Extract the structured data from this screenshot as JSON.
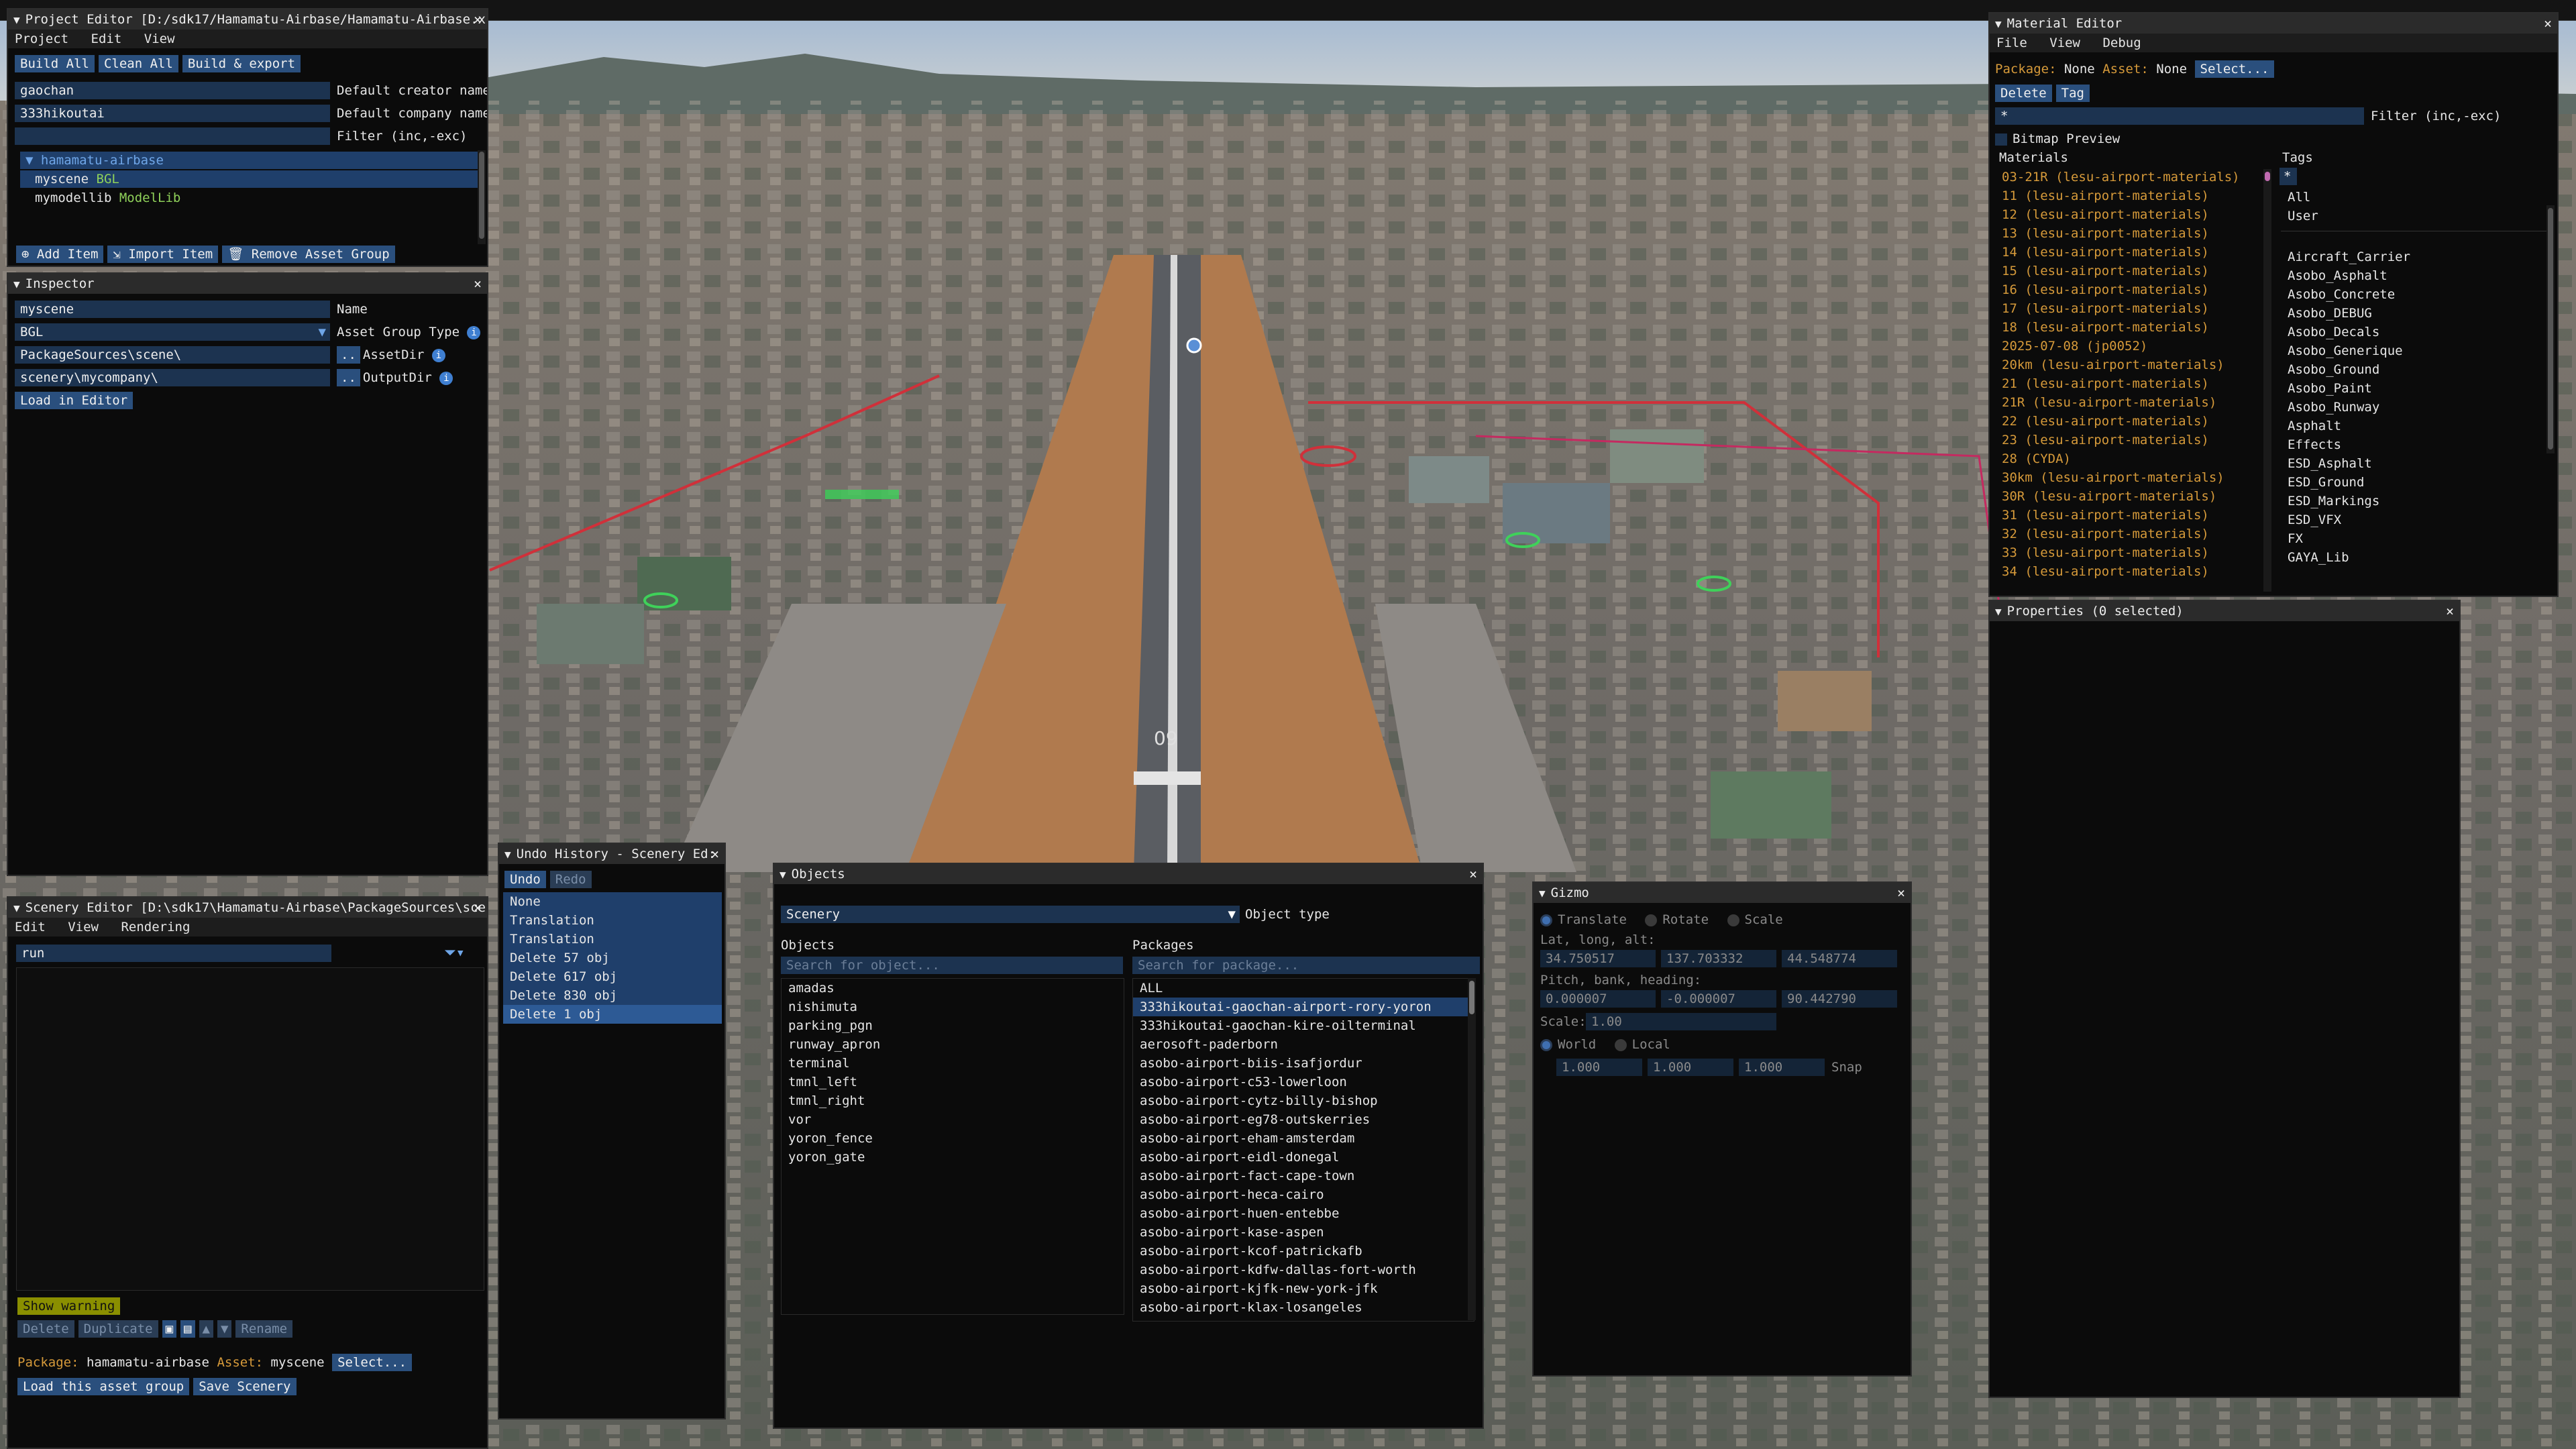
{
  "project_editor": {
    "title": "Project Editor [D:/sdk17/Hamamatu-Airbase/Hamamatu-Airbase.x",
    "menu": [
      "Project",
      "Edit",
      "View"
    ],
    "buttons": {
      "build_all": "Build All",
      "clean_all": "Clean All",
      "build_export": "Build & export"
    },
    "creator_value": "gaochan",
    "creator_label": "Default creator name",
    "company_value": "333hikoutai",
    "company_label": "Default company name",
    "filter_label": "Filter (inc,-exc)",
    "tree": {
      "root": "hamamatu-airbase",
      "item1_name": "myscene",
      "item1_type": "BGL",
      "item2_name": "mymodellib",
      "item2_type": "ModelLib"
    },
    "footer": {
      "add_item": "Add Item",
      "import_item": "Import Item",
      "remove_group": "Remove Asset Group"
    }
  },
  "inspector": {
    "title": "Inspector",
    "name_value": "myscene",
    "name_label": "Name",
    "type_value": "BGL",
    "type_label": "Asset Group Type",
    "assetdir_value": "PackageSources\\scene\\",
    "assetdir_label": "AssetDir",
    "outputdir_value": "scenery\\mycompany\\",
    "outputdir_label": "OutputDir",
    "dots": "..",
    "load_button": "Load in Editor"
  },
  "scenery_editor": {
    "title": "Scenery Editor [D:\\sdk17\\Hamamatu-Airbase\\PackageSources\\sce",
    "menu": [
      "Edit",
      "View",
      "Rendering"
    ],
    "search_value": "run",
    "show_warning": "Show warning",
    "tools": {
      "delete": "Delete",
      "duplicate": "Duplicate",
      "rename": "Rename"
    },
    "package_label": "Package:",
    "package_value": "hamamatu-airbase",
    "asset_label": "Asset:",
    "asset_value": "myscene",
    "select_button": "Select...",
    "load_group": "Load this asset group",
    "save_scenery": "Save Scenery"
  },
  "undo_history": {
    "title": "Undo History - Scenery Ed:",
    "undo": "Undo",
    "redo": "Redo",
    "items": [
      "None",
      "Translation",
      "Translation",
      "Delete 57 obj",
      "Delete 617 obj",
      "Delete 830 obj",
      "Delete 1 obj"
    ]
  },
  "objects": {
    "title": "Objects",
    "type_value": "Scenery",
    "type_label": "Object type",
    "objects_header": "Objects",
    "packages_header": "Packages",
    "objects_placeholder": "Search for object...",
    "packages_placeholder": "Search for package...",
    "object_items": [
      "amadas",
      "nishimuta",
      "parking_pgn",
      "runway_apron",
      "terminal",
      "tmnl_left",
      "tmnl_right",
      "vor",
      "yoron_fence",
      "yoron_gate"
    ],
    "package_items": [
      "ALL",
      "333hikoutai-gaochan-airport-rory-yoron",
      "333hikoutai-gaochan-kire-oilterminal",
      "aerosoft-paderborn",
      "asobo-airport-biis-isafjordur",
      "asobo-airport-c53-lowerloon",
      "asobo-airport-cytz-billy-bishop",
      "asobo-airport-eg78-outskerries",
      "asobo-airport-eham-amsterdam",
      "asobo-airport-eidl-donegal",
      "asobo-airport-fact-cape-town",
      "asobo-airport-heca-cairo",
      "asobo-airport-huen-entebbe",
      "asobo-airport-kase-aspen",
      "asobo-airport-kcof-patrickafb",
      "asobo-airport-kdfw-dallas-fort-worth",
      "asobo-airport-kjfk-new-york-jfk",
      "asobo-airport-klax-losangeles"
    ]
  },
  "gizmo": {
    "title": "Gizmo",
    "modes": [
      "Translate",
      "Rotate",
      "Scale"
    ],
    "latlon_label": "Lat, long, alt:",
    "lat": "34.750517",
    "lon": "137.703332",
    "alt": "44.548774",
    "pbh_label": "Pitch, bank, heading:",
    "pitch": "0.000007",
    "bank": "-0.000007",
    "heading": "90.442790",
    "scale_label": "Scale:",
    "scale_value": "1.00",
    "space": [
      "World",
      "Local"
    ],
    "snap_x": "1.000",
    "snap_y": "1.000",
    "snap_z": "1.000",
    "snap_label": "Snap"
  },
  "material_editor": {
    "title": "Material Editor",
    "menu": [
      "File",
      "View",
      "Debug"
    ],
    "package_label": "Package:",
    "package_value": "None",
    "asset_label": "Asset:",
    "asset_value": "None",
    "select_button": "Select...",
    "delete": "Delete",
    "tag": "Tag",
    "filter_value": "*",
    "filter_label": "Filter (inc,-exc)",
    "bitmap_preview": "Bitmap Preview",
    "materials_header": "Materials",
    "tags_header": "Tags",
    "materials": [
      "03-21R (lesu-airport-materials)",
      "11 (lesu-airport-materials)",
      "12 (lesu-airport-materials)",
      "13 (lesu-airport-materials)",
      "14 (lesu-airport-materials)",
      "15 (lesu-airport-materials)",
      "16 (lesu-airport-materials)",
      "17 (lesu-airport-materials)",
      "18 (lesu-airport-materials)",
      "2025-07-08 (jp0052)",
      "20km (lesu-airport-materials)",
      "21 (lesu-airport-materials)",
      "21R (lesu-airport-materials)",
      "22 (lesu-airport-materials)",
      "23 (lesu-airport-materials)",
      "28 (CYDA)",
      "30km (lesu-airport-materials)",
      "30R (lesu-airport-materials)",
      "31 (lesu-airport-materials)",
      "32 (lesu-airport-materials)",
      "33 (lesu-airport-materials)",
      "34 (lesu-airport-materials)"
    ],
    "tag_filter": "*",
    "tags_top": [
      "All",
      "User"
    ],
    "tags": [
      "Aircraft_Carrier",
      "Asobo_Asphalt",
      "Asobo_Concrete",
      "Asobo_DEBUG",
      "Asobo_Decals",
      "Asobo_Generique",
      "Asobo_Ground",
      "Asobo_Paint",
      "Asobo_Runway",
      "Asphalt",
      "Effects",
      "ESD_Asphalt",
      "ESD_Ground",
      "ESD_Markings",
      "ESD_VFX",
      "FX",
      "GAYA_Lib"
    ]
  },
  "properties": {
    "title": "Properties (0 selected)"
  },
  "runway_marking": "09",
  "colors": {
    "accent": "#2a4f7d",
    "field": "#1c3350",
    "material_text": "#d69a3a",
    "type_text": "#8fd15a",
    "warning": "#8a8f00"
  },
  "icons": [
    "info-icon",
    "filter-icon",
    "plus-icon",
    "import-icon",
    "trash-icon",
    "folder-icon",
    "arrow-up-icon",
    "arrow-down-icon",
    "close-icon",
    "triangle-icon"
  ]
}
